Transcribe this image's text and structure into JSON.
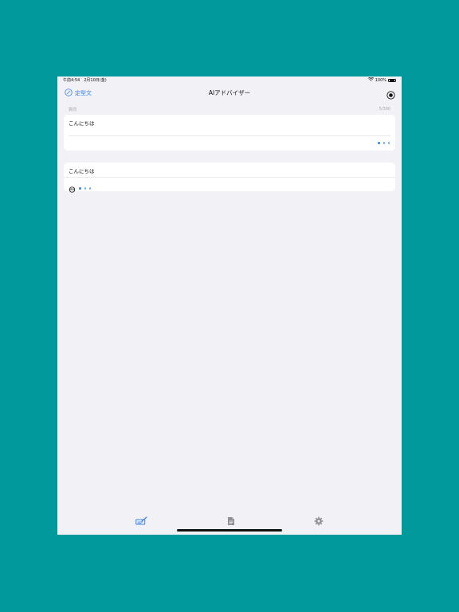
{
  "status_bar": {
    "time": "午前4:54　2月10日(金)",
    "battery": "100%"
  },
  "nav": {
    "left_label": "定型文",
    "title": "AIアドバイザー"
  },
  "meta": {
    "left": "質問",
    "right": "5/300"
  },
  "input_card": {
    "text": "こんにちは"
  },
  "result_card": {
    "title": "こんにちは"
  },
  "tab_bar": {
    "items": [
      "compose-icon",
      "document-icon",
      "gear-icon"
    ],
    "active_index": 0
  },
  "colors": {
    "accent": "#3a82e8",
    "background": "#f1f1f6",
    "frame": "#00999c"
  }
}
